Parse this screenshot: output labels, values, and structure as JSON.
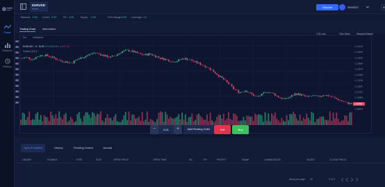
{
  "sidebar": {
    "items": [
      {
        "label": "Trade",
        "icon": "trade-icon",
        "active": true
      },
      {
        "label": "Markets",
        "icon": "markets-icon",
        "active": false
      },
      {
        "label": "History",
        "icon": "history-icon",
        "active": false
      }
    ]
  },
  "topbar": {
    "symbol": "EURUSD",
    "symbol_sub": "Forex",
    "deposit_label": "Deposit",
    "account_id": "9000022",
    "lang": "EN"
  },
  "account": {
    "balance_label": "Balance:",
    "balance": "0.00",
    "credit_label": "Credit:",
    "credit": "0.00",
    "pl_label": "P/L:",
    "pl": "0.00",
    "equity_label": "Equity:",
    "equity": "0.00",
    "free_margin_label": "Free Margin:",
    "free_margin": "0.00",
    "leverage_label": "Leverage:",
    "leverage": "1:0"
  },
  "tabs": [
    {
      "label": "Trading Chart",
      "active": true
    },
    {
      "label": "Information",
      "active": false
    }
  ],
  "info": [
    {
      "label": "0.01 Lots",
      "value": "1,000.00 EUR"
    },
    {
      "label": "Pips Value",
      "value": "$ 0.10"
    },
    {
      "label": "Required Margin",
      "value": "$ 3.00"
    }
  ],
  "chart_toolbar": {
    "interval": "5m",
    "indicators": "Indicators"
  },
  "legend": {
    "symbol": "EURUSD · 5 · EUR",
    "o": "O 1.0",
    "h": "H 1.0",
    "l": "L 1.0",
    "c": "C 1.0",
    "volume": "Volume (20) ▾"
  },
  "order": {
    "qty": "0.01",
    "pending_label": "Add Pending Order",
    "sell_label": "Sell",
    "buy_label": "Buy"
  },
  "bottom": {
    "tabs": [
      {
        "label": "Open Positions",
        "active": true
      },
      {
        "label": "History",
        "active": false
      },
      {
        "label": "Pending Orders",
        "active": false
      },
      {
        "label": "Journal",
        "active": false
      }
    ],
    "columns": [
      "ORDER",
      "SYMBOL",
      "TYPE",
      "SIZE",
      "OPEN PRICE",
      "OPEN TIME",
      "S/L",
      "T/P",
      "PROFIT",
      "SWAP",
      "COMMISSION",
      "TAXES",
      "CLOSE PRICE"
    ],
    "items_per_page_label": "Items per page:",
    "items_per_page": "20",
    "range": "0 of 0"
  },
  "colors": {
    "up": "#39c58a",
    "down": "#e5486b",
    "accent": "#2f6bff"
  },
  "chart_data": {
    "type": "line",
    "title": "",
    "series": [
      {
        "values": [
          1.14,
          1.141,
          1.139,
          1.142,
          1.143,
          1.142,
          1.14,
          1.138,
          1.137,
          1.136,
          1.139,
          1.141,
          1.143,
          1.145,
          1.144,
          1.142,
          1.141,
          1.143,
          1.146,
          1.147,
          1.146,
          1.144,
          1.143,
          1.144,
          1.142,
          1.14,
          1.139,
          1.137,
          1.138,
          1.14,
          1.139,
          1.137,
          1.135,
          1.133,
          1.13,
          1.126,
          1.122,
          1.118,
          1.113,
          1.11,
          1.112,
          1.109,
          1.106,
          1.108,
          1.111,
          1.109,
          1.106,
          1.104,
          1.106,
          1.109,
          1.108,
          1.106,
          1.107,
          1.106,
          1.108,
          1.107,
          1.105,
          1.103,
          1.101,
          1.1
        ]
      }
    ]
  }
}
